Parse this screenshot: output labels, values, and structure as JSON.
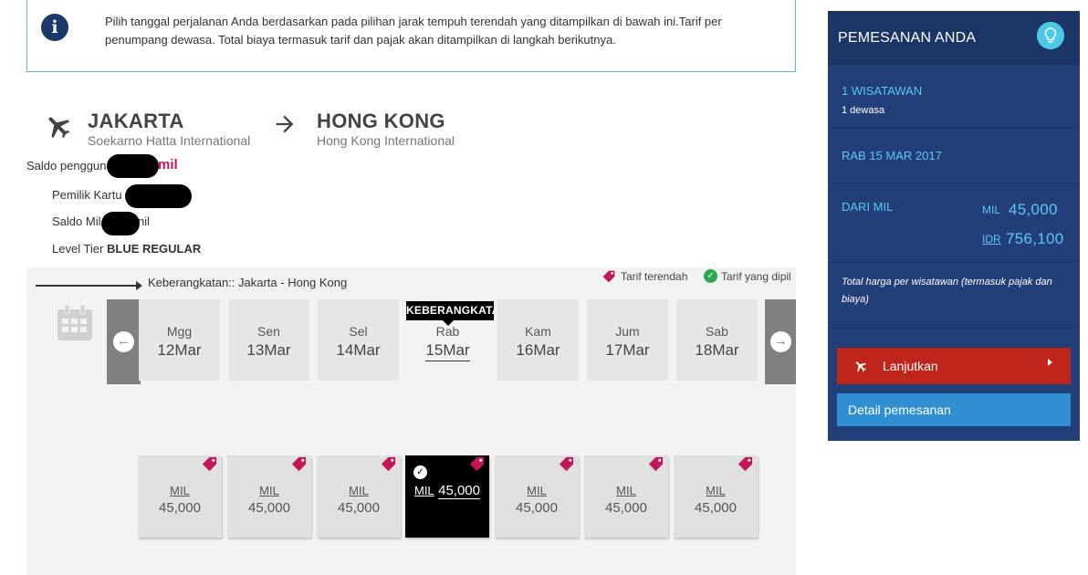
{
  "info": {
    "text": "Pilih tanggal perjalanan Anda berdasarkan pada pilihan jarak tempuh terendah yang ditampilkan di bawah ini.Tarif per penumpang dewasa. Total biaya termasuk tarif dan pajak akan ditampilkan di langkah berikutnya.",
    "icon": "info-icon"
  },
  "route": {
    "origin_city": "JAKARTA",
    "origin_airport": "Soekarno Hatta International",
    "destination_city": "HONG KONG",
    "destination_airport": "Hong Kong International"
  },
  "user": {
    "saldo_label": "Saldo penggun",
    "saldo_unit": "mil",
    "pemilik_label": "Pemilik Kartu",
    "saldo_mil_label": "Saldo Mil",
    "saldo_mil_unit": "nil",
    "level_label": "Level Tier",
    "level_value": "BLUE REGULAR"
  },
  "departure": {
    "label": "Keberangkatan:: Jakarta - Hong Kong",
    "legend_lowest": "Tarif terendah",
    "legend_selected": "Tarif yang dipil",
    "tooltip": "KEBERANGKATA"
  },
  "days": [
    {
      "name": "Mgg",
      "date": "12Mar"
    },
    {
      "name": "Sen",
      "date": "13Mar"
    },
    {
      "name": "Sel",
      "date": "14Mar"
    },
    {
      "name": "Rab",
      "date": "15Mar"
    },
    {
      "name": "Kam",
      "date": "16Mar"
    },
    {
      "name": "Jum",
      "date": "17Mar"
    },
    {
      "name": "Sab",
      "date": "18Mar"
    }
  ],
  "fares": [
    {
      "unit": "MIL",
      "amount": "45,000"
    },
    {
      "unit": "MIL",
      "amount": "45,000"
    },
    {
      "unit": "MIL",
      "amount": "45,000"
    },
    {
      "unit": "MIL",
      "amount": "45,000"
    },
    {
      "unit": "MIL",
      "amount": "45,000"
    },
    {
      "unit": "MIL",
      "amount": "45,000"
    },
    {
      "unit": "MIL",
      "amount": "45,000"
    }
  ],
  "sidebar": {
    "title": "PEMESANAN ANDA",
    "travelers": "1 WISATAWAN",
    "adults": "1 dewasa",
    "date": "RAB 15 MAR 2017",
    "from_label": "DARI MIL",
    "mil_label": "MIL",
    "mil_value": "45,000",
    "idr_label": "IDR",
    "idr_value": "756,100",
    "note": "Total harga per wisatawan (termasuk pajak dan biaya)",
    "continue": "Lanjutkan",
    "details": "Detail pemesanan"
  },
  "colors": {
    "navy": "#233f7a",
    "cyan": "#5bc8ef",
    "red": "#c0251b",
    "blue_button": "#2f8fd0",
    "tag_pink": "#c2185b",
    "check_green": "#2ca84a"
  }
}
